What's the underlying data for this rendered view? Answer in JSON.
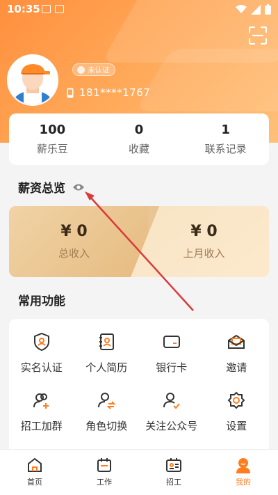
{
  "status_bar": {
    "time": "10:35"
  },
  "profile": {
    "verify_badge": "未认证",
    "phone": "181****1767"
  },
  "stats": [
    {
      "value": "100",
      "label": "薪乐豆"
    },
    {
      "value": "0",
      "label": "收藏"
    },
    {
      "value": "1",
      "label": "联系记录"
    }
  ],
  "salary": {
    "title": "薪资总览",
    "total_amount": "¥ 0",
    "total_label": "总收入",
    "last_month_amount": "¥ 0",
    "last_month_label": "上月收入"
  },
  "functions": {
    "title": "常用功能",
    "items": [
      {
        "label": "实名认证",
        "icon": "shield-user-icon"
      },
      {
        "label": "个人简历",
        "icon": "resume-icon"
      },
      {
        "label": "银行卡",
        "icon": "bank-card-icon"
      },
      {
        "label": "邀请",
        "icon": "invite-mail-icon"
      },
      {
        "label": "招工加群",
        "icon": "add-group-icon"
      },
      {
        "label": "角色切换",
        "icon": "switch-role-icon"
      },
      {
        "label": "关注公众号",
        "icon": "follow-account-icon"
      },
      {
        "label": "设置",
        "icon": "settings-gear-icon"
      }
    ]
  },
  "tabbar": [
    {
      "label": "首页",
      "icon": "home-icon"
    },
    {
      "label": "工作",
      "icon": "work-calendar-icon"
    },
    {
      "label": "招工",
      "icon": "recruit-board-icon"
    },
    {
      "label": "我的",
      "icon": "profile-icon"
    }
  ],
  "colors": {
    "accent": "#ff7d1f",
    "header": "#ffa757"
  }
}
